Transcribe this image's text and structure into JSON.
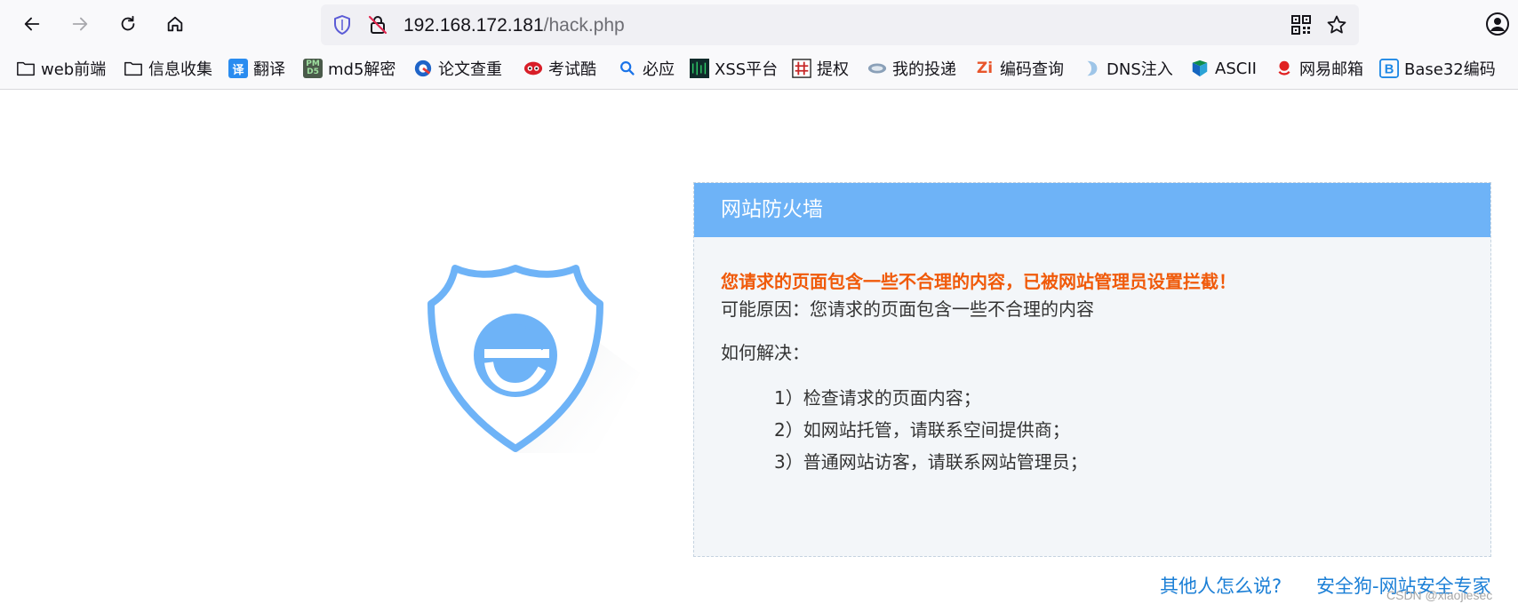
{
  "browser": {
    "url_host": "192.168.172.181",
    "url_path": "/hack.php",
    "nav_icons": [
      "back-icon",
      "forward-icon",
      "reload-icon",
      "home-icon"
    ],
    "urlbar_icons": [
      "tracking-protection-icon",
      "insecure-lock-icon",
      "qr-code-icon",
      "bookmark-star-icon"
    ],
    "account_icon": "account-icon"
  },
  "bookmarks": [
    {
      "label": "web前端",
      "icon": "folder-icon"
    },
    {
      "label": "信息收集",
      "icon": "folder-icon"
    },
    {
      "label": "翻译",
      "icon": "translate-icon"
    },
    {
      "label": "md5解密",
      "icon": "pmd5-icon"
    },
    {
      "label": "论文查重",
      "icon": "paper-check-icon"
    },
    {
      "label": "考试酷",
      "icon": "examcoo-icon"
    },
    {
      "label": "必应",
      "icon": "bing-search-icon"
    },
    {
      "label": "XSS平台",
      "icon": "xss-icon"
    },
    {
      "label": "提权",
      "icon": "hash-icon"
    },
    {
      "label": "我的投递",
      "icon": "delivery-icon"
    },
    {
      "label": "编码查询",
      "icon": "zi-icon"
    },
    {
      "label": "DNS注入",
      "icon": "dns-icon"
    },
    {
      "label": "ASCII",
      "icon": "ascii-icon"
    },
    {
      "label": "网易邮箱",
      "icon": "netease-mail-icon"
    },
    {
      "label": "Base32编码",
      "icon": "base32-icon"
    }
  ],
  "waf": {
    "title": "网站防火墙",
    "warning": "您请求的页面包含一些不合理的内容，已被网站管理员设置拦截！",
    "reason": "可能原因：您请求的页面包含一些不合理的内容",
    "howto": "如何解决：",
    "steps": [
      "1）检查请求的页面内容；",
      "2）如网站托管，请联系空间提供商；",
      "3）普通网站访客，请联系网站管理员；"
    ]
  },
  "footer": {
    "others_link": "其他人怎么说?",
    "brand_link": "安全狗-网站安全专家"
  },
  "watermark": "CSDN @xiaojiesec",
  "colors": {
    "header": "#6eb3f7",
    "warning": "#f05a0a",
    "link": "#1b7fd6",
    "shield": "#6eb3f7"
  }
}
